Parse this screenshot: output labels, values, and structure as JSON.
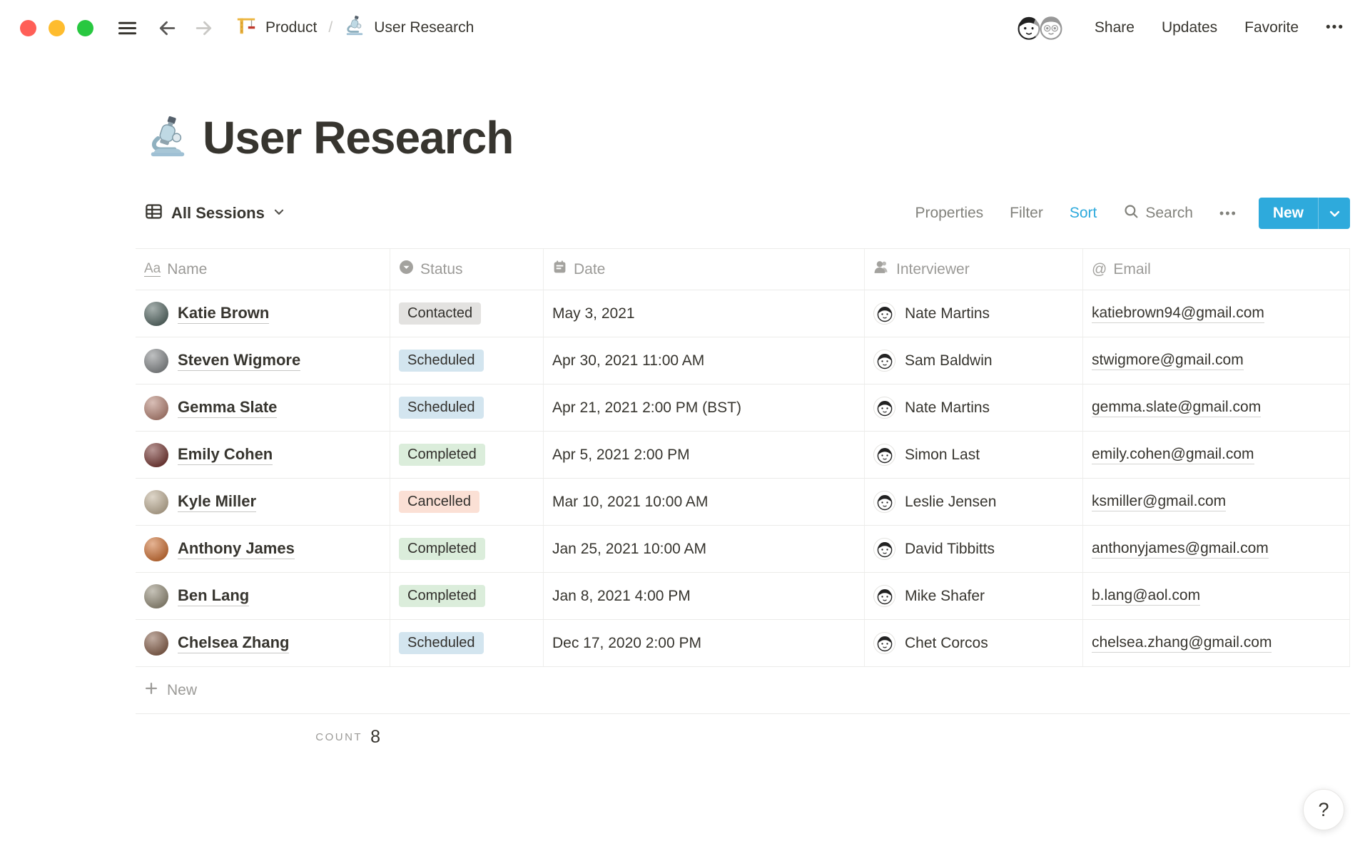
{
  "window": {
    "traffic_lights": [
      "#FF5F57",
      "#FEBC2E",
      "#28C840"
    ],
    "breadcrumb": {
      "parent": "Product",
      "separator": "/",
      "current": "User Research"
    },
    "actions": {
      "share": "Share",
      "updates": "Updates",
      "favorite": "Favorite",
      "more": "•••"
    }
  },
  "page": {
    "title": "User Research",
    "icon": "microscope"
  },
  "toolbar": {
    "view_name": "All Sessions",
    "properties": "Properties",
    "filter": "Filter",
    "sort": "Sort",
    "search": "Search",
    "more": "•••",
    "new_label": "New"
  },
  "colors": {
    "accent": "#2EAADC",
    "status": {
      "gray": "#E3E2E0",
      "blue": "#D3E5EF",
      "green": "#DBEDDB",
      "red": "#FBE0D5"
    }
  },
  "table": {
    "headers": [
      {
        "label": "Name",
        "icon": "text-property-icon"
      },
      {
        "label": "Status",
        "icon": "select-property-icon"
      },
      {
        "label": "Date",
        "icon": "date-property-icon"
      },
      {
        "label": "Interviewer",
        "icon": "person-property-icon"
      },
      {
        "label": "Email",
        "icon": "email-property-icon"
      }
    ],
    "rows": [
      {
        "name": "Katie Brown",
        "avatar_color": "#5d6f6b",
        "status": "Contacted",
        "status_color": "gray",
        "date": "May 3, 2021",
        "interviewer": "Nate Martins",
        "email": "katiebrown94@gmail.com"
      },
      {
        "name": "Steven Wigmore",
        "avatar_color": "#8a8d8f",
        "status": "Scheduled",
        "status_color": "blue",
        "date": "Apr 30, 2021 11:00 AM",
        "interviewer": "Sam Baldwin",
        "email": "stwigmore@gmail.com"
      },
      {
        "name": "Gemma Slate",
        "avatar_color": "#b9897b",
        "status": "Scheduled",
        "status_color": "blue",
        "date": "Apr 21, 2021 2:00 PM (BST)",
        "interviewer": "Nate Martins",
        "email": "gemma.slate@gmail.com"
      },
      {
        "name": "Emily Cohen",
        "avatar_color": "#7c403c",
        "status": "Completed",
        "status_color": "green",
        "date": "Apr 5, 2021 2:00 PM",
        "interviewer": "Simon Last",
        "email": "emily.cohen@gmail.com"
      },
      {
        "name": "Kyle Miller",
        "avatar_color": "#c3b49c",
        "status": "Cancelled",
        "status_color": "red",
        "date": "Mar 10, 2021 10:00 AM",
        "interviewer": "Leslie Jensen",
        "email": "ksmiller@gmail.com"
      },
      {
        "name": "Anthony James",
        "avatar_color": "#d0763c",
        "status": "Completed",
        "status_color": "green",
        "date": "Jan 25, 2021 10:00 AM",
        "interviewer": "David Tibbitts",
        "email": "anthonyjames@gmail.com"
      },
      {
        "name": "Ben Lang",
        "avatar_color": "#98917e",
        "status": "Completed",
        "status_color": "green",
        "date": "Jan 8, 2021 4:00 PM",
        "interviewer": "Mike Shafer",
        "email": "b.lang@aol.com"
      },
      {
        "name": "Chelsea Zhang",
        "avatar_color": "#8c6753",
        "status": "Scheduled",
        "status_color": "blue",
        "date": "Dec 17, 2020 2:00 PM",
        "interviewer": "Chet Corcos",
        "email": "chelsea.zhang@gmail.com"
      }
    ],
    "new_row_label": "New",
    "count_label": "COUNT",
    "count_value": "8"
  },
  "help": {
    "label": "?"
  }
}
